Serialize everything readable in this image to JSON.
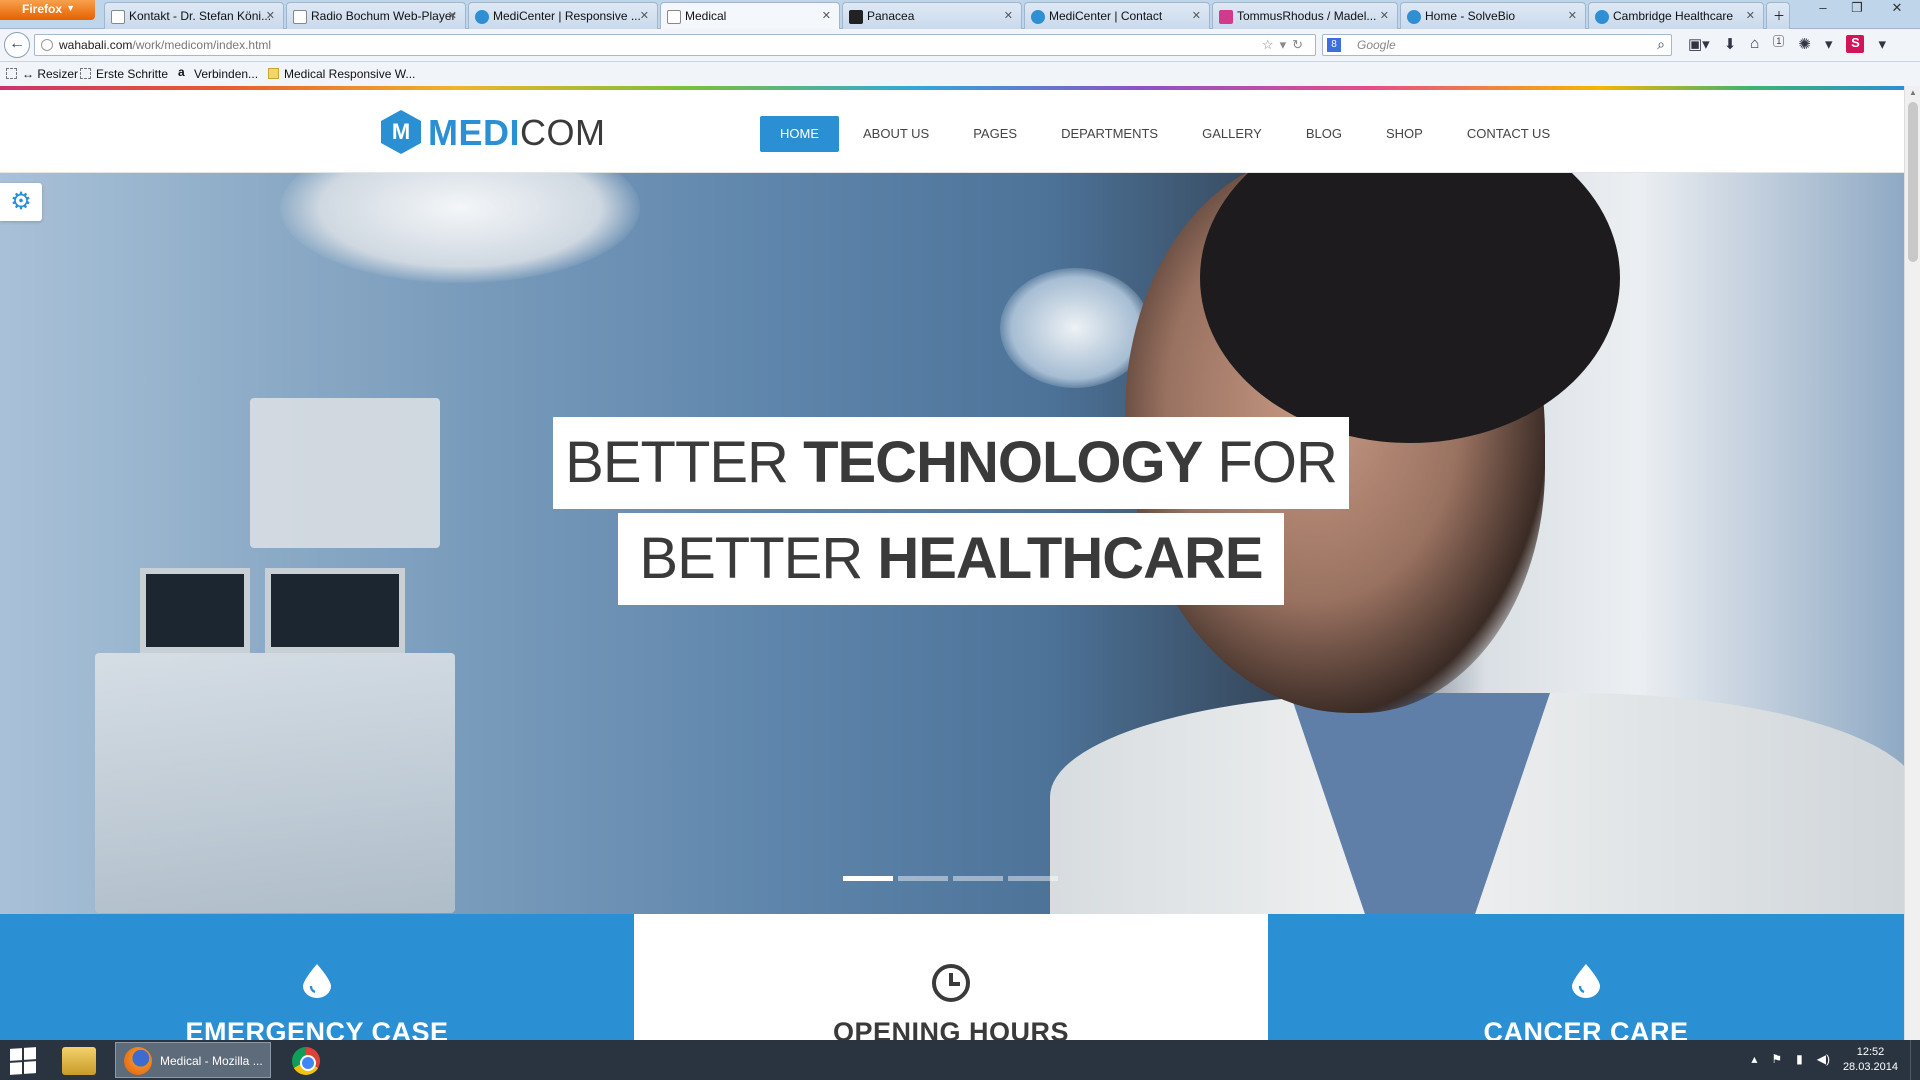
{
  "browser": {
    "menu_button": "Firefox",
    "tabs": [
      {
        "title": "Kontakt - Dr. Stefan Köni..."
      },
      {
        "title": "Radio Bochum Web-Player"
      },
      {
        "title": "MediCenter | Responsive ..."
      },
      {
        "title": "Medical"
      },
      {
        "title": "Panacea"
      },
      {
        "title": "MediCenter | Contact"
      },
      {
        "title": "TommusRhodus / Madel..."
      },
      {
        "title": "Home - SolveBio"
      },
      {
        "title": "Cambridge Healthcare"
      }
    ],
    "url_host": "wahabali.com",
    "url_path": "/work/medicom/index.html",
    "search_placeholder": "Google",
    "bookmarks": [
      "↔ Resizer",
      "Erste Schritte",
      "Verbinden...",
      "Medical Responsive W..."
    ],
    "notification_count": "1"
  },
  "site": {
    "logo_prefix": "MEDI",
    "logo_suffix": "COM",
    "logo_letter": "M",
    "nav": [
      "HOME",
      "ABOUT US",
      "PAGES",
      "DEPARTMENTS",
      "GALLERY",
      "BLOG",
      "SHOP",
      "CONTACT US"
    ],
    "hero": {
      "line1_a": "BETTER ",
      "line1_b": "TECHNOLOGY",
      "line1_c": " FOR",
      "line2_a": "BETTER ",
      "line2_b": "HEALTHCARE"
    },
    "features": [
      "EMERGENCY CASE",
      "OPENING HOURS",
      "CANCER CARE"
    ]
  },
  "taskbar": {
    "active_window": "Medical - Mozilla ...",
    "time": "12:52",
    "date": "28.03.2014"
  },
  "colors": {
    "accent": "#2b8fd4",
    "text_dark": "#3a3a3a"
  }
}
